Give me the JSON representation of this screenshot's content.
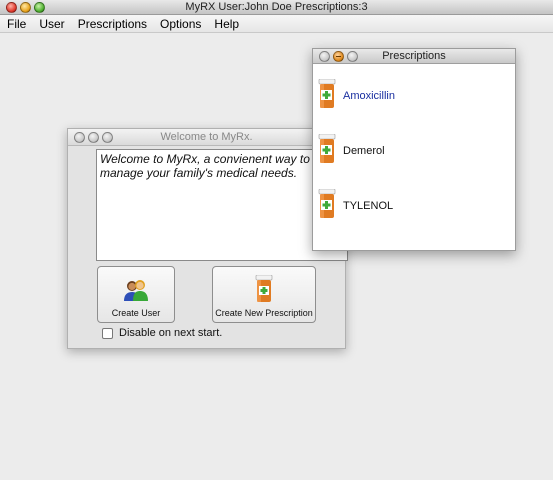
{
  "main_window": {
    "title": "MyRX User:John Doe  Prescriptions:3"
  },
  "menu": [
    "File",
    "User",
    "Prescriptions",
    "Options",
    "Help"
  ],
  "welcome_window": {
    "title": "Welcome to MyRx.",
    "message": "Welcome to MyRx, a convienent way to manage your family's medical needs.",
    "create_user_label": "Create User",
    "create_prescription_label": "Create New Prescription",
    "disable_checkbox_label": "Disable on next start.",
    "disable_checked": false
  },
  "prescriptions_window": {
    "title": "Prescriptions",
    "items": [
      {
        "name": "Amoxicillin",
        "selected": true,
        "icon": "pill-bottle-icon"
      },
      {
        "name": "Demerol",
        "selected": false,
        "icon": "pill-bottle-icon"
      },
      {
        "name": "TYLENOL",
        "selected": false,
        "icon": "pill-bottle-icon"
      }
    ]
  },
  "colors": {
    "selected_text": "#1a2fa0",
    "bottle_orange": "#e07b22",
    "cross_green": "#3faa3a"
  }
}
